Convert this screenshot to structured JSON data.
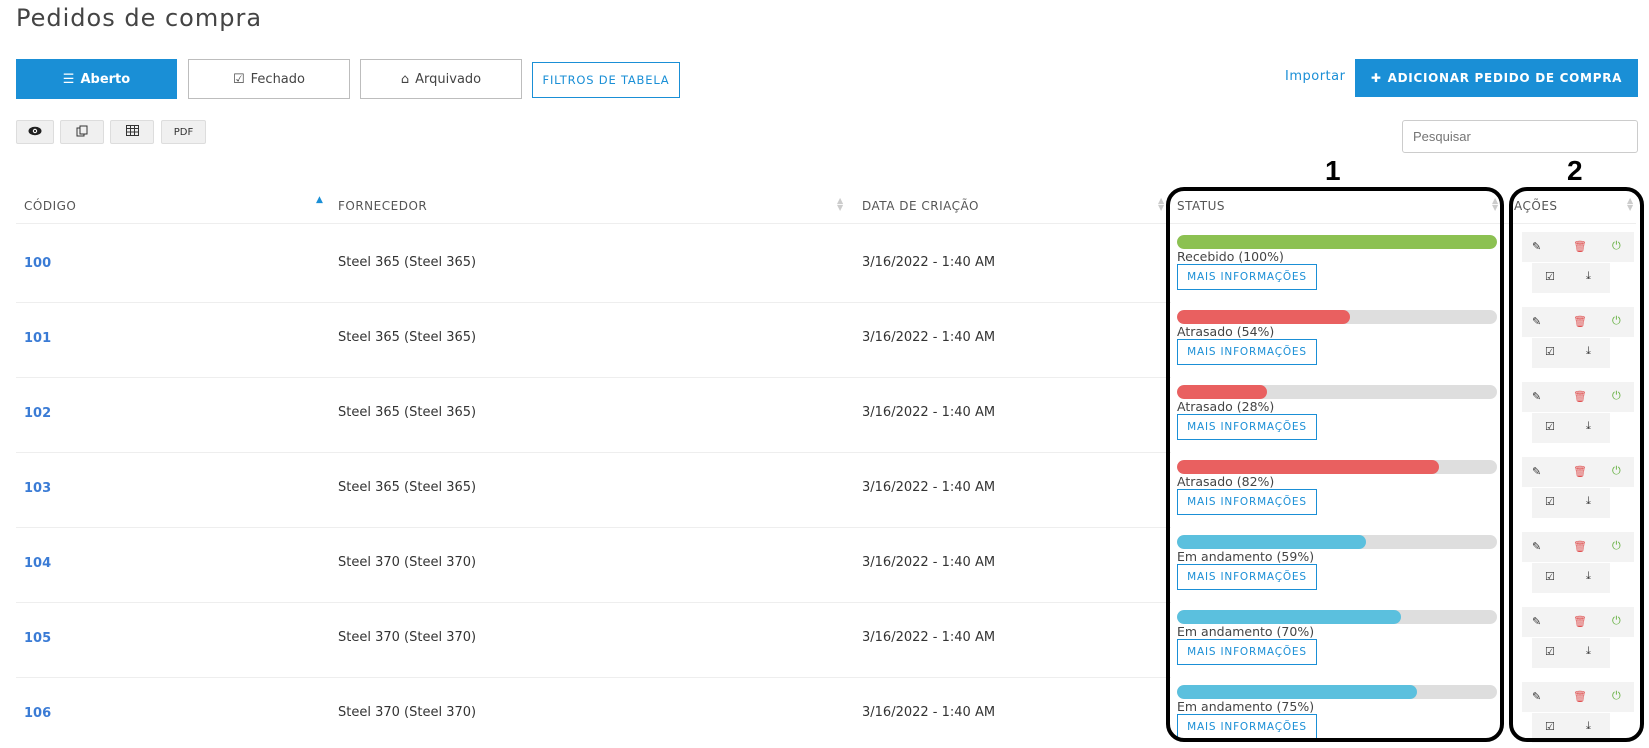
{
  "page": {
    "title": "Pedidos de compra"
  },
  "tabs": {
    "aberto": {
      "icon": "list-icon",
      "label": "Aberto"
    },
    "fechado": {
      "icon": "checkbox-icon",
      "label": "Fechado"
    },
    "arquivado": {
      "icon": "inbox-icon",
      "label": "Arquivado"
    }
  },
  "filters_label": "FILTROS DE TABELA",
  "importar_label": "Importar",
  "add_button_label": "ADICIONAR PEDIDO DE COMPRA",
  "toolbar": {
    "pdf_label": "PDF"
  },
  "search": {
    "placeholder": "Pesquisar"
  },
  "table": {
    "headers": {
      "code": "CÓDIGO",
      "supplier": "FORNECEDOR",
      "date": "DATA DE CRIAÇÃO",
      "status": "STATUS",
      "actions": "AÇÕES"
    },
    "rows": [
      {
        "code": "100",
        "supplier": "Steel 365 (Steel 365)",
        "date": "3/16/2022 - 1:40 AM",
        "status": "Recebido (100%)",
        "progress": 100,
        "kind": "received",
        "more": "MAIS INFORMAÇÕES"
      },
      {
        "code": "101",
        "supplier": "Steel 365 (Steel 365)",
        "date": "3/16/2022 - 1:40 AM",
        "status": "Atrasado (54%)",
        "progress": 54,
        "kind": "late",
        "more": "MAIS INFORMAÇÕES"
      },
      {
        "code": "102",
        "supplier": "Steel 365 (Steel 365)",
        "date": "3/16/2022 - 1:40 AM",
        "status": "Atrasado (28%)",
        "progress": 28,
        "kind": "late",
        "more": "MAIS INFORMAÇÕES"
      },
      {
        "code": "103",
        "supplier": "Steel 365 (Steel 365)",
        "date": "3/16/2022 - 1:40 AM",
        "status": "Atrasado (82%)",
        "progress": 82,
        "kind": "late",
        "more": "MAIS INFORMAÇÕES"
      },
      {
        "code": "104",
        "supplier": "Steel 370 (Steel 370)",
        "date": "3/16/2022 - 1:40 AM",
        "status": "Em andamento (59%)",
        "progress": 59,
        "kind": "progress",
        "more": "MAIS INFORMAÇÕES"
      },
      {
        "code": "105",
        "supplier": "Steel 370 (Steel 370)",
        "date": "3/16/2022 - 1:40 AM",
        "status": "Em andamento (70%)",
        "progress": 70,
        "kind": "progress",
        "more": "MAIS INFORMAÇÕES"
      },
      {
        "code": "106",
        "supplier": "Steel 370 (Steel 370)",
        "date": "3/16/2022 - 1:40 AM",
        "status": "Em andamento (75%)",
        "progress": 75,
        "kind": "progress",
        "more": "MAIS INFORMAÇÕES"
      }
    ]
  },
  "status_colors": {
    "received": "#8cc152",
    "late": "#e96060",
    "progress": "#5bc0de"
  },
  "callouts": [
    "1",
    "2"
  ]
}
